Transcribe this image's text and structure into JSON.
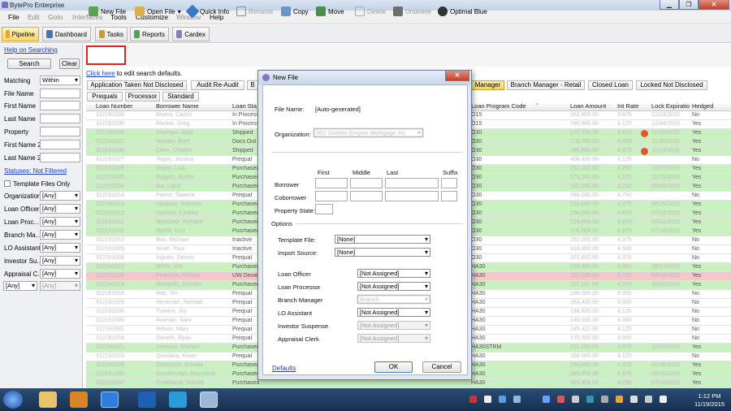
{
  "window": {
    "title": "BytePro Enterprise"
  },
  "menu": [
    {
      "label": "File",
      "enabled": true
    },
    {
      "label": "Edit",
      "enabled": false
    },
    {
      "label": "Goto",
      "enabled": false
    },
    {
      "label": "Interfaces",
      "enabled": false
    },
    {
      "label": "Tools",
      "enabled": true
    },
    {
      "label": "Customize",
      "enabled": true
    },
    {
      "label": "Window",
      "enabled": false
    },
    {
      "label": "Help",
      "enabled": true
    }
  ],
  "nav_tabs": [
    {
      "label": "Pipeline",
      "active": true
    },
    {
      "label": "Dashboard"
    },
    {
      "label": "Tasks"
    },
    {
      "label": "Reports"
    },
    {
      "label": "Cardex"
    }
  ],
  "left_panel": {
    "help_link": "Help on Searching",
    "search_label": "Search",
    "clear_label": "Clear",
    "matching_label": "Matching",
    "matching_value": "Within",
    "fields": [
      "File Name",
      "First Name",
      "Last Name",
      "Property",
      "First Name 2",
      "Last Name 2"
    ],
    "statuses_link": "Statuses: Not Filtered",
    "template_files_label": "Template Files Only",
    "filters": [
      {
        "label": "Organization",
        "value": "[Any]"
      },
      {
        "label": "Loan Officer",
        "value": "[Any]"
      },
      {
        "label": "Loan Proc...",
        "value": "[Any]"
      },
      {
        "label": "Branch Ma...",
        "value": "[Any]"
      },
      {
        "label": "LO Assistant",
        "value": "[Any]"
      },
      {
        "label": "Investor Su...",
        "value": "[Any]"
      },
      {
        "label": "Appraisal C...",
        "value": "[Any]"
      }
    ],
    "extra_combo_1": "[Any]",
    "extra_combo_2": "[Any]"
  },
  "actions": [
    {
      "label": "New File",
      "enabled": true
    },
    {
      "label": "Open File",
      "enabled": true
    },
    {
      "label": "Quick Info",
      "enabled": true
    },
    {
      "label": "Rename",
      "enabled": false
    },
    {
      "label": "Copy",
      "enabled": true
    },
    {
      "label": "Move",
      "enabled": true
    },
    {
      "label": "Delete",
      "enabled": false
    },
    {
      "label": "Undelete",
      "enabled": false
    },
    {
      "label": "Optimal Blue",
      "enabled": true
    }
  ],
  "search_defaults": {
    "link": "Click here",
    "rest": " to edit search defaults."
  },
  "filter_tabs_row1": [
    "Application Taken Not Disclosed",
    "Audit Re-Audit",
    "B",
    "Manager",
    "Branch Manager - Retail",
    "Closed Loan",
    "Locked Not Disclosed"
  ],
  "filter_tabs_row2": [
    "Prequals",
    "Processor",
    "Standard"
  ],
  "grid": {
    "columns": [
      "Loan Number",
      "Borrower Name",
      "Loan Sta",
      "",
      "Loan Program Code",
      "Loan Amount",
      "Int Rate",
      "Lock Expiratio",
      "Hedged"
    ],
    "rows": [
      {
        "n": "312161033",
        "b": "Rivera, Carlos",
        "s": "In Process",
        "p": "O15",
        "a": "162,800.00",
        "r": "3.875",
        "d": "12/24/2015",
        "h": "No",
        "c": "w"
      },
      {
        "n": "312161035",
        "b": "Rocker, Greg",
        "s": "In Process",
        "p": "O15",
        "a": "160,000.00",
        "r": "4.125",
        "d": "12/04/2015",
        "h": "Yes",
        "c": "w"
      },
      {
        "n": "312161036",
        "b": "Jauregui, Aleja",
        "s": "Shipped",
        "p": "O30",
        "a": "170,750.00",
        "r": "4.625",
        "d": "11/19/2015",
        "h": "Yes",
        "c": "g",
        "x": true
      },
      {
        "n": "312161037",
        "b": "Nicolas, Brett",
        "s": "Docs Out",
        "p": "O30",
        "a": "176,760.00",
        "r": "4.000",
        "d": "11/30/2015",
        "h": "Yes",
        "c": "g"
      },
      {
        "n": "312161038",
        "b": "Chrin, Charles",
        "s": "Shipped",
        "p": "O30",
        "a": "165,800.00",
        "r": "4.375",
        "d": "11/13/2015",
        "h": "Yes",
        "c": "g",
        "x": true
      },
      {
        "n": "312161027",
        "b": "Tegon, Jessica",
        "s": "Prequal",
        "p": "O30",
        "a": "408,430.00",
        "r": "4.125",
        "d": "",
        "h": "No",
        "c": "w"
      },
      {
        "n": "312161026",
        "b": "Tegon, Lisa",
        "s": "Purchased",
        "p": "O30",
        "a": "252,310.00",
        "r": "4.250",
        "d": "10/27/2015",
        "h": "Yes",
        "c": "g"
      },
      {
        "n": "312161025",
        "b": "Biggers, Audrei",
        "s": "Purchased",
        "p": "O30",
        "a": "173,160.00",
        "r": "4.125",
        "d": "10/15/2015",
        "h": "Yes",
        "c": "g"
      },
      {
        "n": "312161034",
        "b": "Bui, Larry",
        "s": "Purchased",
        "p": "O30",
        "a": "192,000.00",
        "r": "4.250",
        "d": "09/03/2015",
        "h": "Yes",
        "c": "g"
      },
      {
        "n": "312161014",
        "b": "Pierce, Tawana",
        "s": "Prequal",
        "p": "O30",
        "a": "286,000.00",
        "r": "4.750",
        "d": "",
        "h": "No",
        "c": "w"
      },
      {
        "n": "312161013",
        "b": "Vasquez, Roberto",
        "s": "Purchased",
        "p": "O30",
        "a": "216,000.00",
        "r": "4.375",
        "d": "06/29/2015",
        "h": "Yes",
        "c": "g"
      },
      {
        "n": "312161012",
        "b": "Hanson, Cynthia",
        "s": "Purchased",
        "p": "O30",
        "a": "298,000.00",
        "r": "4.625",
        "d": "07/14/2015",
        "h": "Yes",
        "c": "g"
      },
      {
        "n": "312161011",
        "b": "Westover, Richard",
        "s": "Purchased",
        "p": "O30",
        "a": "224,000.00",
        "r": "4.500",
        "d": "07/02/2015",
        "h": "Yes",
        "c": "g"
      },
      {
        "n": "312161002",
        "b": "Moffitt, Kurt",
        "s": "Purchased",
        "p": "O30",
        "a": "176,000.00",
        "r": "4.375",
        "d": "07/16/2015",
        "h": "Yes",
        "c": "g"
      },
      {
        "n": "312161010",
        "b": "Buu, Michael",
        "s": "Inactive",
        "p": "O30",
        "a": "252,000.00",
        "r": "4.375",
        "d": "",
        "h": "No",
        "c": "w"
      },
      {
        "n": "312161009",
        "b": "Israel, Paul",
        "s": "Inactive",
        "p": "O30",
        "a": "318,000.00",
        "r": "4.500",
        "d": "",
        "h": "No",
        "c": "w"
      },
      {
        "n": "312161008",
        "b": "Ingram, Dennis",
        "s": "Prequal",
        "p": "O30",
        "a": "201,600.00",
        "r": "4.375",
        "d": "",
        "h": "No",
        "c": "w"
      },
      {
        "n": "312161022",
        "b": "White, Joe",
        "s": "Purchased",
        "p": "HA30",
        "a": "218,960.00",
        "r": "4.000",
        "d": "09/17/2015",
        "h": "Yes",
        "c": "g"
      },
      {
        "n": "312161020",
        "b": "Peterson, Robbie",
        "s": "UW Denied",
        "p": "HA30",
        "a": "159,000.00",
        "r": "4.125",
        "d": "09/04/2015",
        "h": "Yes",
        "c": "p"
      },
      {
        "n": "312161018",
        "b": "Richards, Jennifer",
        "s": "Purchased",
        "p": "HA30",
        "a": "227,187.00",
        "r": "4.250",
        "d": "10/09/2015",
        "h": "Yes",
        "c": "g"
      },
      {
        "n": "312161016",
        "b": "Hall, Tim",
        "s": "Prequal",
        "p": "HA30",
        "a": "196,000.00",
        "r": "4.000",
        "d": "",
        "h": "No",
        "c": "w"
      },
      {
        "n": "312161029",
        "b": "Heckman, Randall",
        "s": "Prequal",
        "p": "HA30",
        "a": "163,400.00",
        "r": "4.000",
        "d": "",
        "h": "No",
        "c": "w"
      },
      {
        "n": "312161030",
        "b": "Travers, Joy",
        "s": "Prequal",
        "p": "HA30",
        "a": "198,600.00",
        "r": "4.125",
        "d": "",
        "h": "No",
        "c": "w"
      },
      {
        "n": "312161000",
        "b": "Avanian, Sara",
        "s": "Prequal",
        "p": "HA30",
        "a": "149,000.00",
        "r": "4.000",
        "d": "",
        "h": "No",
        "c": "w"
      },
      {
        "n": "312161001",
        "b": "Wilson, Mary",
        "s": "Prequal",
        "p": "HA30",
        "a": "245,411.00",
        "r": "4.125",
        "d": "",
        "h": "No",
        "c": "w"
      },
      {
        "n": "312161004",
        "b": "Daniels, Ryan",
        "s": "Prequal",
        "p": "HA30",
        "a": "175,000.00",
        "r": "4.000",
        "d": "",
        "h": "No",
        "c": "w"
      },
      {
        "n": "312161021",
        "b": "Johnson, Michael",
        "s": "Purchased",
        "p": "HA30STRM",
        "a": "211,000.00",
        "r": "3.875",
        "d": "10/31/2015",
        "h": "Yes",
        "c": "g"
      },
      {
        "n": "312161023",
        "b": "Quintana, Kevin",
        "s": "Prequal",
        "p": "HA30",
        "a": "168,000.00",
        "r": "4.125",
        "d": "",
        "h": "No",
        "c": "w"
      },
      {
        "n": "312161006",
        "b": "Denniston, Donald",
        "s": "Purchased",
        "p": "HA30",
        "a": "294,000.00",
        "r": "4.375",
        "d": "07/30/2015",
        "h": "Yes",
        "c": "g"
      },
      {
        "n": "312161005",
        "b": "Gruzbrecher, Raymond",
        "s": "Purchased",
        "p": "HA30",
        "a": "385,900.00",
        "r": "4.375",
        "d": "06/16/2015",
        "h": "Yes",
        "c": "g"
      },
      {
        "n": "312161007",
        "b": "Truelblood, Donald",
        "s": "Purchased",
        "p": "HA30",
        "a": "391,403.00",
        "r": "4.250",
        "d": "07/10/2015",
        "h": "Yes",
        "c": "g"
      }
    ]
  },
  "dialog": {
    "title": "New File",
    "file_name_label": "File Name:",
    "file_name_value": "[Auto-generated]",
    "organization_label": "Organization:",
    "organization_value": "002 Golden Empire Mortgage Inc",
    "name_headers": [
      "First",
      "Middle",
      "Last",
      "Suffix"
    ],
    "borrower_label": "Borrower",
    "coborrower_label": "Coborrower",
    "property_state_label": "Property State:",
    "options_label": "Options",
    "template_file_label": "Template File:",
    "template_file_value": "[None]",
    "import_source_label": "Import Source:",
    "import_source_value": "[None]",
    "assignments": [
      {
        "label": "Loan Officer",
        "value": "[Not Assigned]",
        "enabled": true
      },
      {
        "label": "Loan Processor",
        "value": "[Not Assigned]",
        "enabled": true
      },
      {
        "label": "Branch Manager",
        "value": "Branch",
        "enabled": true
      },
      {
        "label": "LO Assistant",
        "value": "[Not Assigned]",
        "enabled": true
      },
      {
        "label": "Investor Suspense",
        "value": "[Not Assigned]",
        "enabled": false
      },
      {
        "label": "Appraisal Clerk",
        "value": "[Not Assigned]",
        "enabled": false
      }
    ],
    "defaults_link": "Defaults",
    "ok_label": "OK",
    "cancel_label": "Cancel"
  },
  "taskbar": {
    "time": "1:12 PM",
    "date": "11/19/2015"
  }
}
